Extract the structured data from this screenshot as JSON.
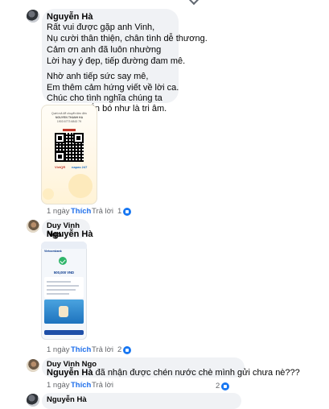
{
  "comments": [
    {
      "author": "Nguyễn Hà",
      "lines": [
        "Rất vui được gặp anh Vinh,",
        "Nụ cười thân thiện, chân tình dễ thương.",
        "Cảm ơn anh đã luôn nhường",
        "Lời hay ý đẹp, tiếp đường đam mê.",
        "Nhờ anh tiếp sức say mê,",
        "Em thêm cảm hứng viết về lời ca.",
        "Chúc cho tình nghĩa chúng ta",
        "Luôn vui, gắn bó như là tri âm."
      ],
      "attachment": {
        "type": "qr-transfer-card",
        "title_1": "Quét mã để chuyển tiền đến",
        "title_2": "NGUYEN THANH HA",
        "title_3": "1903 6773 6843 79",
        "brand_left": "VietQR",
        "brand_right": "napas 247"
      },
      "actions": {
        "time": "1 ngày",
        "like": "Thích",
        "reply": "Trả lời"
      },
      "reactions": "1"
    },
    {
      "author": "Duy Vinh Ngo",
      "mention": "Nguyễn Hà",
      "text": "",
      "attachment": {
        "type": "phone-screenshot",
        "app": "Vietcombank",
        "amount": "500,000 VND"
      },
      "actions": {
        "time": "1 ngày",
        "like": "Thích",
        "reply": "Trả lời"
      },
      "reactions": "2"
    },
    {
      "author": "Duy Vinh Ngo",
      "mention": "Nguyễn Hà",
      "text": " đã nhận được chén nước chè mình gửi chưa nè???",
      "actions": {
        "time": "1 ngày",
        "like": "Thích",
        "reply": "Trả lời"
      },
      "reactions": "2"
    },
    {
      "author": "Nguyễn Hà"
    }
  ],
  "colors": {
    "like": "#1f6feb",
    "bubble": "#f0f2f5",
    "reaction": "#1877f2"
  }
}
